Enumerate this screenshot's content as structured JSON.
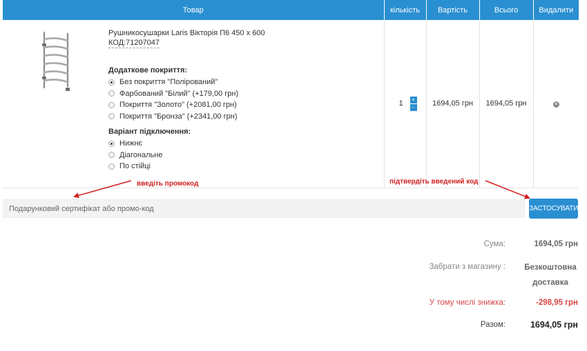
{
  "table": {
    "headers": {
      "product": "Товар",
      "quantity": "кількість",
      "price": "Вартість",
      "total": "Всього",
      "remove": "Видалити"
    },
    "item": {
      "name": "Рушникосушарки Laris Вікторія П6 450 х 600",
      "code": "КОД:71207047",
      "image_icon": "towel-rail-image",
      "coating_title": "Додаткове покриття:",
      "coating_options": [
        {
          "label": "Без покриття \"Полірований\"",
          "selected": true
        },
        {
          "label": "Фарбований \"Білий\" (+179,00 грн)",
          "selected": false
        },
        {
          "label": "Покриття \"Золото\" (+2081,00 грн)",
          "selected": false
        },
        {
          "label": "Покриття \"Бронза\" (+2341,00 грн)",
          "selected": false
        }
      ],
      "connection_title": "Варіант підключення:",
      "connection_options": [
        {
          "label": "Нижнє",
          "selected": true
        },
        {
          "label": "Діагональне",
          "selected": false
        },
        {
          "label": "По стійці",
          "selected": false
        }
      ],
      "quantity": "1",
      "qty_plus": "+",
      "qty_minus": "-",
      "price": "1694,05 грн",
      "total": "1694,05 грн",
      "remove_icon": "remove-circle-icon"
    }
  },
  "hints": {
    "promo": "введіть промокод",
    "confirm": "підтвердіть введений код",
    "color": "#d02020"
  },
  "promo": {
    "placeholder": "Подарунковий сертифікат або промо-код",
    "apply_label": "ЗАСТОСУВАТИ"
  },
  "summary": {
    "sum_label": "Сума:",
    "sum_value": "1694,05 грн",
    "pickup_label": "Забрати з магазину :",
    "pickup_value": "Безкоштовна доставка",
    "discount_label": "У тому числі знижка:",
    "discount_value": "-298,95 грн",
    "total_label": "Разом:",
    "total_value": "1694,05 грн"
  },
  "colors": {
    "accent": "#2a8fd1",
    "discount": "#d64545"
  }
}
